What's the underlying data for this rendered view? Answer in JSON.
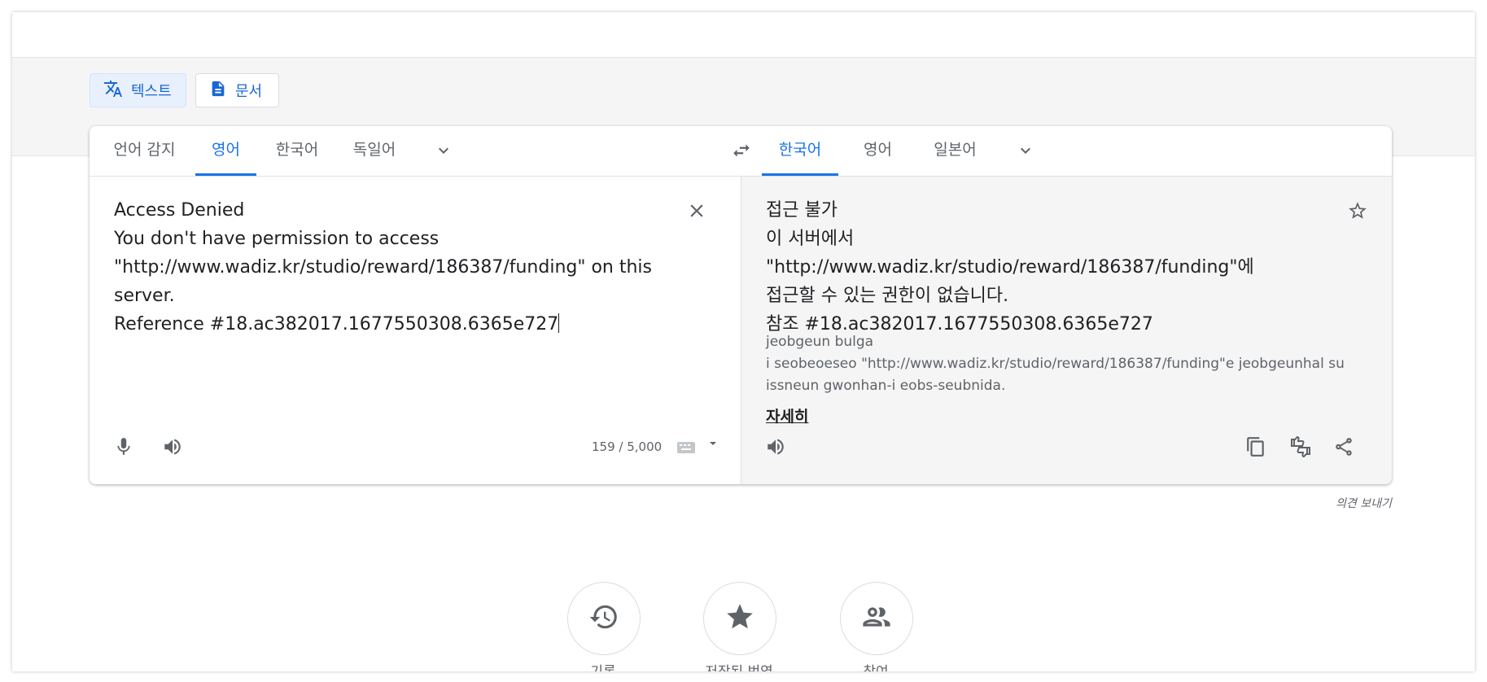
{
  "modes": [
    {
      "label": "텍스트",
      "icon": "translate-icon",
      "active": true
    },
    {
      "label": "문서",
      "icon": "document-icon",
      "active": false
    }
  ],
  "source_langs": [
    "언어 감지",
    "영어",
    "한국어",
    "독일어"
  ],
  "source_selected": "영어",
  "target_langs": [
    "한국어",
    "영어",
    "일본어"
  ],
  "target_selected": "한국어",
  "source_text": "Access Denied\nYou don't have permission to access\n\"http://www.wadiz.kr/studio/reward/186387/funding\" on this server.\nReference #18.ac382017.1677550308.6365e727",
  "char_count": "159 / 5,000",
  "target_text": "접근 불가\n이 서버에서 \"http://www.wadiz.kr/studio/reward/186387/funding\"에\n접근할 수 있는 권한이 없습니다.\n참조 #18.ac382017.1677550308.6365e727",
  "romanization": "jeobgeun bulga\ni seobeoeseo \"http://www.wadiz.kr/studio/reward/186387/funding\"e jeobgeunhal su issneun gwonhan-i eobs-seubnida.",
  "more_link": "자세히",
  "feedback": "의견 보내기",
  "bottom_actions": [
    {
      "label": "기록",
      "icon": "history-icon"
    },
    {
      "label": "저장된 번역",
      "icon": "star-icon"
    },
    {
      "label": "참여",
      "icon": "community-icon"
    }
  ],
  "colors": {
    "accent": "#1a73e8",
    "target_bg": "#f5f5f5"
  }
}
